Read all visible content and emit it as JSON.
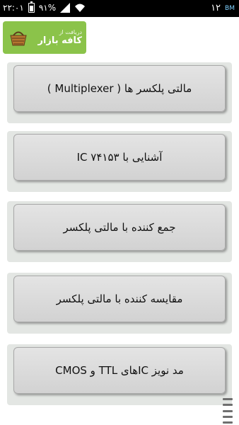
{
  "status_bar": {
    "time": "۲۲:۰۱",
    "battery": "۹۱%",
    "clock_right": "۱۲",
    "app_badge": "BM"
  },
  "store_badge": {
    "small_text": "دریافت از",
    "big_text": "کافه بازار"
  },
  "menu": {
    "items": [
      {
        "label": "مالتی پلکسر ها ( Multiplexer )"
      },
      {
        "label": "آشنایی با IC ۷۴۱۵۳"
      },
      {
        "label": "جمع کننده با مالتی پلکسر"
      },
      {
        "label": "مقایسه کننده با مالتی پلکسر"
      },
      {
        "label": "مد نویز ICهای TTL و CMOS"
      }
    ]
  },
  "colors": {
    "status_bar_bg": "#000000",
    "badge_green": "#8bc34a",
    "card_face": "#d8d8d8",
    "card_back": "#e3e6e3"
  }
}
